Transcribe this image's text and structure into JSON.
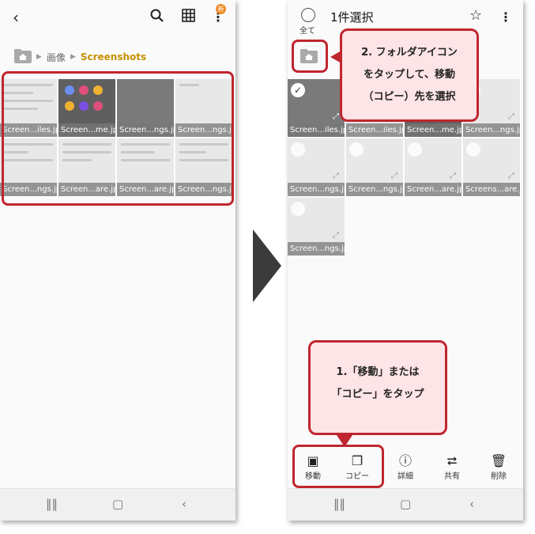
{
  "left": {
    "breadcrumb": {
      "segment1": "画像",
      "current": "Screenshots"
    },
    "badge": "新",
    "thumbnails": [
      "Screen...iles.jpg",
      "Screen...me.jpg",
      "Screen...ngs.jpg",
      "Screen...ngs.jpg",
      "Screen...ngs.jpg",
      "Screen...are.jpg",
      "Screen...are.jpg",
      "Screen...ngs.jpg"
    ]
  },
  "right": {
    "header_title": "1件選択",
    "select_all_label": "全て",
    "thumbnails": [
      "Screen...iles.jpg",
      "Screen...iles.jpg",
      "Screen...me.jpg",
      "Screen...ngs.jpg",
      "Screen...ngs.jpg",
      "Screen...ngs.jpg",
      "Screen...are.jpg",
      "Screens...are.jpg",
      "Screen...ngs.jpg"
    ],
    "toolbar": {
      "move": "移動",
      "copy": "コピー",
      "details": "詳細",
      "share": "共有",
      "delete": "削除"
    }
  },
  "callouts": {
    "top_line1": "2. フォルダアイコン",
    "top_line2": "をタップして、移動",
    "top_line3": "（コピー）先を選択",
    "bottom_line1": "1.「移動」または",
    "bottom_line2": "「コピー」をタップ"
  },
  "icons": {
    "back": "chevron-left-icon",
    "search": "search-icon",
    "grid": "grid-view-icon",
    "more": "more-vert-icon",
    "star": "star-icon"
  },
  "colors": {
    "accent": "#c79200",
    "callout_border": "#c0262f",
    "callout_fill": "#fde4e6"
  }
}
